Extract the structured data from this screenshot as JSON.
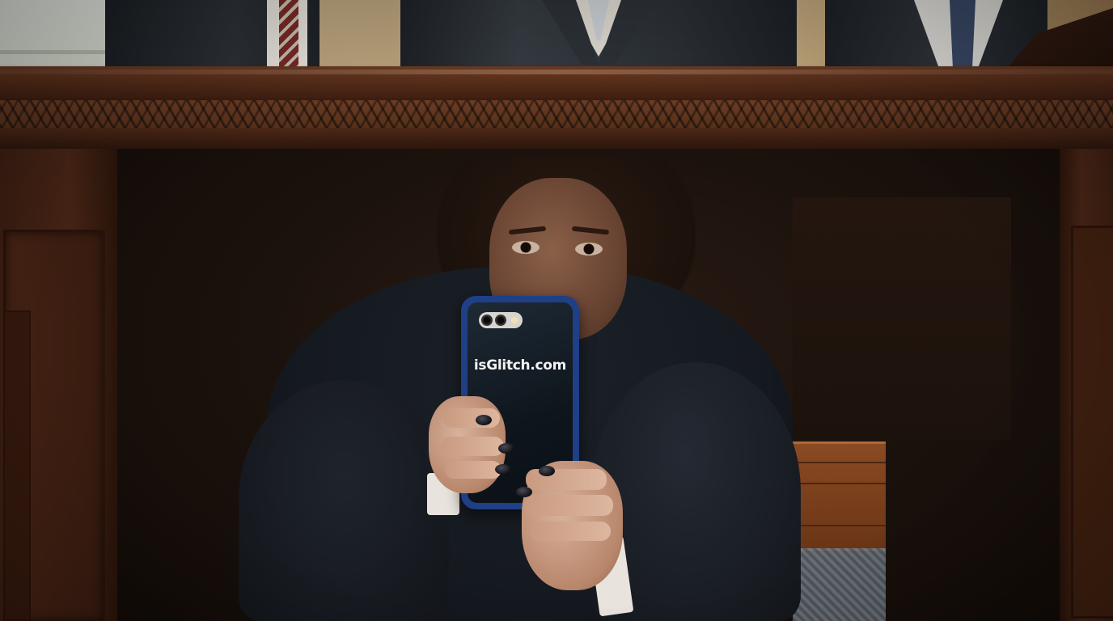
{
  "scene": {
    "phone_text": "isGlitch.com"
  },
  "colors": {
    "desk_wood": "#5a2f1b",
    "phone_case": "#1f3f86",
    "suit": "#151920",
    "nail_polish": "#101016"
  },
  "icons": {
    "phone_camera": "phone-camera-icon"
  }
}
